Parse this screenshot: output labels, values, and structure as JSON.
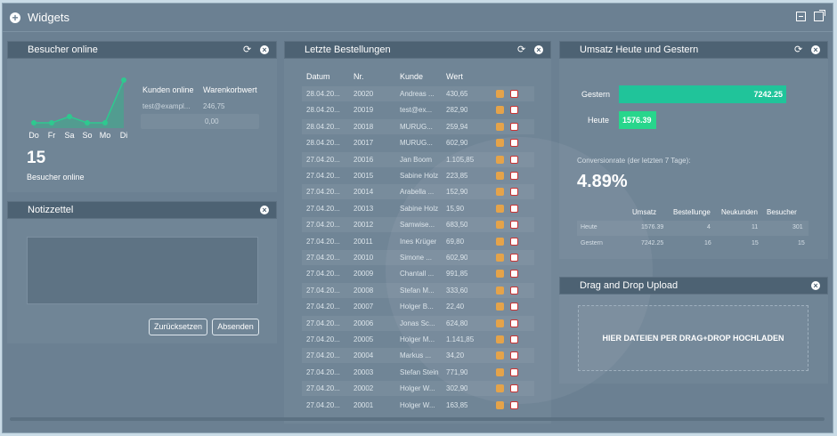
{
  "window": {
    "title": "Widgets"
  },
  "besucher": {
    "title": "Besucher online",
    "days": [
      "Do",
      "Fr",
      "Sa",
      "So",
      "Mo",
      "Di"
    ],
    "count": "15",
    "count_label": "Besucher online",
    "table_headers": [
      "Kunden online",
      "Warenkorbwert"
    ],
    "rows": [
      {
        "kunde": "test@exampl...",
        "wert": "246,75"
      },
      {
        "kunde": "",
        "wert": "0,00"
      }
    ]
  },
  "notiz": {
    "title": "Notizzettel",
    "reset_label": "Zurücksetzen",
    "send_label": "Absenden"
  },
  "bestell": {
    "title": "Letzte Bestellungen",
    "headers": [
      "Datum",
      "Nr.",
      "Kunde",
      "Wert"
    ],
    "rows": [
      [
        "28.04.20...",
        "20020",
        "Andreas ...",
        "430,65"
      ],
      [
        "28.04.20...",
        "20019",
        "test@ex...",
        "282,90"
      ],
      [
        "28.04.20...",
        "20018",
        "MURUG...",
        "259,94"
      ],
      [
        "28.04.20...",
        "20017",
        "MURUG...",
        "602,90"
      ],
      [
        "27.04.20...",
        "20016",
        "Jan Boom",
        "1.105,85"
      ],
      [
        "27.04.20...",
        "20015",
        "Sabine Holz",
        "223,85"
      ],
      [
        "27.04.20...",
        "20014",
        "Arabella ...",
        "152,90"
      ],
      [
        "27.04.20...",
        "20013",
        "Sabine Holz",
        "15,90"
      ],
      [
        "27.04.20...",
        "20012",
        "Samwise...",
        "683,50"
      ],
      [
        "27.04.20...",
        "20011",
        "Ines Krüger",
        "69,80"
      ],
      [
        "27.04.20...",
        "20010",
        "Simone ...",
        "602,90"
      ],
      [
        "27.04.20...",
        "20009",
        "Chantall ...",
        "991,85"
      ],
      [
        "27.04.20...",
        "20008",
        "Stefan M...",
        "333,60"
      ],
      [
        "27.04.20...",
        "20007",
        "Holger B...",
        "22,40"
      ],
      [
        "27.04.20...",
        "20006",
        "Jonas Sc...",
        "624,80"
      ],
      [
        "27.04.20...",
        "20005",
        "Holger M...",
        "1.141,85"
      ],
      [
        "27.04.20...",
        "20004",
        "Markus ...",
        "34,20"
      ],
      [
        "27.04.20...",
        "20003",
        "Stefan Stein",
        "771,90"
      ],
      [
        "27.04.20...",
        "20002",
        "Holger W...",
        "302,90"
      ],
      [
        "27.04.20...",
        "20001",
        "Holger W...",
        "163,85"
      ]
    ]
  },
  "umsatz": {
    "title": "Umsatz Heute und Gestern",
    "bars": [
      {
        "label": "Gestern",
        "value": "7242.25"
      },
      {
        "label": "Heute",
        "value": "1576.39"
      }
    ],
    "conversion_label": "Conversionrate (der letzten 7 Tage):",
    "conversion_value": "4.89%",
    "table_headers": [
      "Umsatz",
      "Bestellunge",
      "Neukunden",
      "Besucher"
    ],
    "table_rows": [
      [
        "Heute",
        "1576.39",
        "4",
        "11",
        "301"
      ],
      [
        "Gestern",
        "7242.25",
        "16",
        "15",
        "15"
      ]
    ]
  },
  "upload": {
    "title": "Drag and Drop Upload",
    "dropzone_text": "HIER DATEIEN PER DRAG+DROP HOCHLADEN"
  },
  "colors": {
    "accent_green": "#20c49a",
    "panel_header": "#4d6273",
    "window_bg": "#6b8092"
  }
}
